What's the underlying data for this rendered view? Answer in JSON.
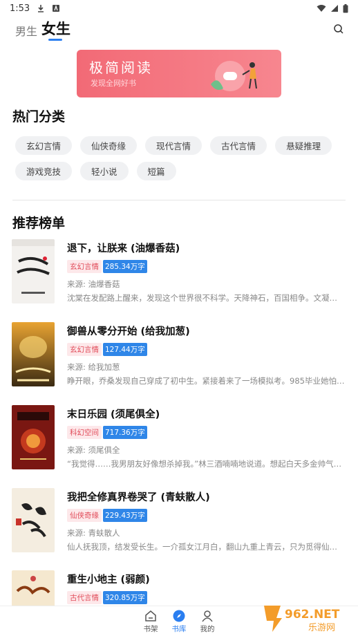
{
  "status": {
    "time": "1:53"
  },
  "header": {
    "tab_male": "男生",
    "tab_female": "女生",
    "active_tab": "女生"
  },
  "banner": {
    "title": "极简阅读",
    "subtitle": "发现全网好书"
  },
  "hot_section": {
    "title": "热门分类",
    "categories": [
      "玄幻言情",
      "仙侠奇缘",
      "现代言情",
      "古代言情",
      "悬疑推理",
      "游戏竞技",
      "轻小说",
      "短篇"
    ]
  },
  "rank_section": {
    "title": "推荐榜单"
  },
  "books": [
    {
      "title": "退下，让朕来 (油爆香菇)",
      "category": "玄幻言情",
      "words": "285.34万字",
      "source": "来源: 油爆香菇",
      "desc": "沈棠在发配路上醒来，发现这个世界很不科学。天降神石，百国相争。文凝文…",
      "cover_text": "退下让朕来"
    },
    {
      "title": "御兽从零分开始 (给我加葱)",
      "category": "玄幻言情",
      "words": "127.44万字",
      "source": "来源: 给我加葱",
      "desc": "睁开眼，乔桑发现自己穿成了初中生。紧接着来了一场模拟考。985毕业她怕…",
      "cover_text": "御兽从零分开始"
    },
    {
      "title": "末日乐园 (须尾俱全)",
      "category": "科幻空间",
      "words": "717.36万字",
      "source": "来源: 须尾俱全",
      "desc": "“我觉得……我男朋友好像想杀掉我。”林三酒喃喃地说道。想起白天多金帅气又…",
      "cover_text": "末日乐园"
    },
    {
      "title": "我把全修真界卷哭了 (青蚨散人)",
      "category": "仙侠奇缘",
      "words": "229.43万字",
      "source": "来源: 青蚨散人",
      "desc": "仙人抚我顶，结发受长生。一介孤女江月白，翻山九重上青云，只为觅得仙人…",
      "cover_text": "全修真界卷哭了"
    },
    {
      "title": "重生小地主 (弱颜)",
      "category": "古代言情",
      "words": "320.85万字",
      "source": "",
      "desc": "",
      "cover_text": "重生小地主"
    }
  ],
  "bottom_nav": {
    "shelf": "书架",
    "store": "书库",
    "mine": "我的"
  },
  "watermark": {
    "text_main": "962.NET",
    "text_sub": "乐游网"
  },
  "colors": {
    "accent": "#2a7ef0",
    "banner": "#f26a76",
    "tag_red": "#e14c5a",
    "tag_blue": "#2f86e8"
  }
}
